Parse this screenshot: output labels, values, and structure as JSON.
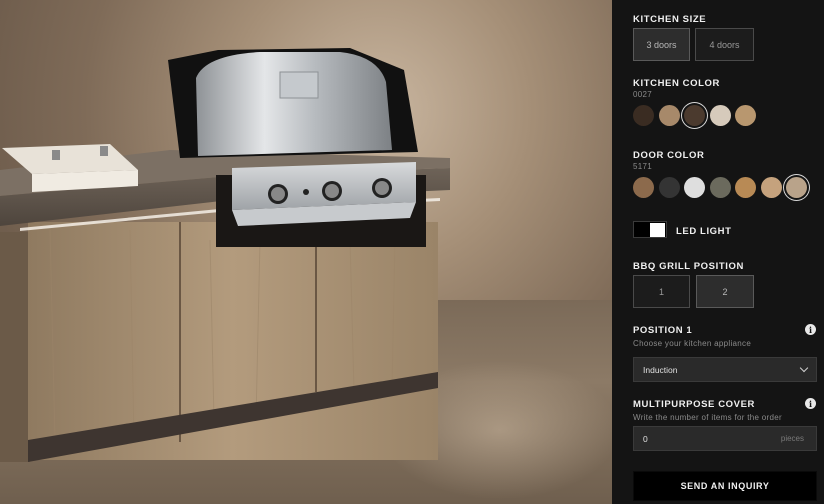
{
  "kitchen_size": {
    "title": "KITCHEN SIZE",
    "options": [
      "3 doors",
      "4 doors"
    ],
    "selected": "3 doors"
  },
  "kitchen_color": {
    "title": "KITCHEN COLOR",
    "code": "0027",
    "swatches": [
      {
        "name": "dark-walnut",
        "color": "#3a2c22"
      },
      {
        "name": "light-oak",
        "color": "#a7896a"
      },
      {
        "name": "dark-wenge",
        "color": "#4b3a2e"
      },
      {
        "name": "white-oak",
        "color": "#d6cabb"
      },
      {
        "name": "natural-oak",
        "color": "#b8976f"
      }
    ],
    "selected_index": 2
  },
  "door_color": {
    "title": "DOOR COLOR",
    "code": "5171",
    "swatches": [
      {
        "name": "walnut",
        "color": "#8c6a4c"
      },
      {
        "name": "anthracite",
        "color": "#343434"
      },
      {
        "name": "white",
        "color": "#dedede"
      },
      {
        "name": "olive-grey",
        "color": "#6b6a5d"
      },
      {
        "name": "golden-oak",
        "color": "#b88a55"
      },
      {
        "name": "sand-oak",
        "color": "#c5a27d"
      },
      {
        "name": "bleached-oak",
        "color": "#b9a38a"
      }
    ],
    "selected_index": 6
  },
  "led_light": {
    "label": "LED LIGHT",
    "enabled": true
  },
  "bbq_grill_position": {
    "title": "BBQ GRILL POSITION",
    "options": [
      "1",
      "2"
    ],
    "selected": "2"
  },
  "position_1": {
    "title": "POSITION 1",
    "subtitle": "Choose your kitchen appliance",
    "selected": "Induction"
  },
  "multipurpose_cover": {
    "title": "MULTIPURPOSE COVER",
    "subtitle": "Write the number of items for the order",
    "value": "0",
    "unit": "pieces"
  },
  "cta": {
    "label": "SEND AN INQUIRY"
  }
}
